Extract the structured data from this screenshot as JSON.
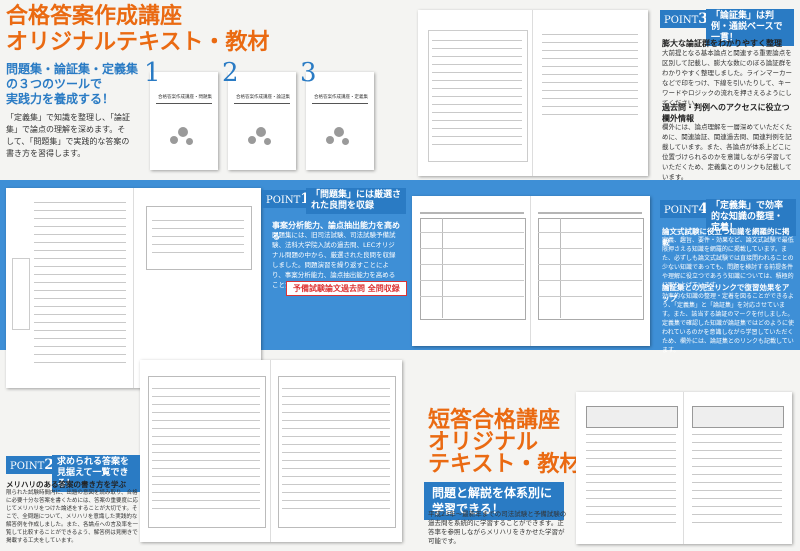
{
  "top": {
    "title_line1": "合格答案作成講座",
    "title_line2": "オリジナルテキスト・教材",
    "subhead_line1": "問題集・論証集・定義集",
    "subhead_line2": "の３つのツールで",
    "subhead_line3": "実践力を養成する！",
    "body": "「定義集」で知識を整理し、「論証集」で論点の理解を深めます。そして、「問題集」で実践的な答案の書き方を習得します。"
  },
  "covers": [
    {
      "num": "1",
      "title": "合格答案作成講座・問題集"
    },
    {
      "num": "2",
      "title": "合格答案作成講座・論証集"
    },
    {
      "num": "3",
      "title": "合格答案作成講座・定義集"
    }
  ],
  "points": {
    "p1": {
      "label": "POINT",
      "num": "1",
      "head": "「問題集」には厳選された良問を収録",
      "lead": "事案分析能力、論点抽出能力を高める",
      "body": "問題集には、旧司法試験、司法試験予備試験、法科大学院入試の過去問、LECオリジナル問題の中から、厳選された良問を収録しました。問題演習を繰り返すことにより、事案分析能力、論点抽出能力を高めることができます。",
      "tag": "予備試験論文過去問 全問収録"
    },
    "p2": {
      "label": "POINT",
      "num": "2",
      "head": "求められる答案を見据えて一覧できる！",
      "lead": "メリハリのある答案の書き方を学ぶ",
      "body": "限られた試験時間内に、出題の意図を読み取り、合格に必要十分な答案を書くためには、答案の重要度に応じてメリハリをつけた論述をすることが大切です。そこで、全問題について、メリハリを意識した実践的な解答例を作成しました。また、各論点への言及率を一覧して比較することができるよう、解答例は見開きで掲載する工夫をしています。"
    },
    "p3": {
      "label": "POINT",
      "num": "3",
      "head": "「論証集」は判例・通説ベースで一貫！",
      "lead1": "膨大な論証群をわかりやすく整理",
      "body1": "大前提となる基本論点と関連する重要論点を区別して記載し、膨大な数にのぼる論証群をわかりやすく整理しました。ラインマーカーなどで印をつけ、下線を引いたりして、キーワードやロジックの流れを押さえるようにしてください。",
      "lead2": "過去問・判例へのアクセスに役立つ欄外情報",
      "body2": "欄外には、論点理解を一層深めていただくために、関連論証、関連過去問、関連判例を記載しています。また、各論点が体系上どこに位置づけられるのかを意識しながら学習していただくため、定義集とのリンクも記載しています。"
    },
    "p4": {
      "label": "POINT",
      "num": "4",
      "head": "「定義集」で効率的な知識の整理・定着！",
      "lead1": "論文式試験に役立つ知識を網羅的に掲載",
      "body1": "定義、趣旨、要件・効果など、論文式試験で最低限押さえる知識を網羅的に掲載しています。また、必ずしも論文式試験では直接問われることの少ない知識であっても、問題を検討する前提条件や理解に役立つであろう知識については、積極的に取り上げています。",
      "lead2": "論証集との完全リンクで復習効果をアップ",
      "body2": "効率的な知識の整理・定着を図ることができるよう、「定義集」と「論証集」を対応させています。また、該当する論証のマークを付しました。定義集で確認した知識が論証集ではどのように使われているのかを意識しながら学習していただくため、欄外には、論証集とのリンクも記載しています。"
    }
  },
  "bottom": {
    "title_line1": "短答合格講座",
    "title_line2": "オリジナル",
    "title_line3": "テキスト・教材",
    "box_line1": "問題と解説を体系別に",
    "box_line2": "学習できる！",
    "body": "平成23年～最新年までの司法試験と予備試験の過去問を系統的に学習することができます。正答率を参照しながらメリハリをきかせた学習が可能です。"
  },
  "colors": {
    "accent": "#ea6a12",
    "brand_blue": "#2a7bc4",
    "band_blue": "#3e8fd6"
  }
}
